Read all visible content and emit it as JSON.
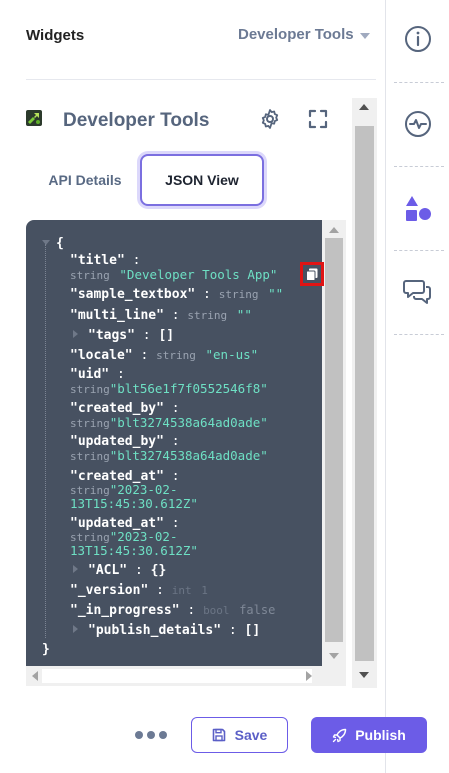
{
  "header": {
    "title": "Widgets",
    "selected_widget": "Developer Tools"
  },
  "rail": {
    "icons": [
      "info-icon",
      "activity-icon",
      "shapes-icon",
      "chat-icon"
    ]
  },
  "panel": {
    "title": "Developer Tools",
    "tabs": [
      {
        "label": "API Details",
        "active": false
      },
      {
        "label": "JSON View",
        "active": true
      }
    ]
  },
  "json": {
    "open_brace": "{",
    "close_brace": "}",
    "fields": {
      "title": {
        "key": "\"title\"",
        "type": "string",
        "value": "\"Developer Tools App\""
      },
      "sample_textbox": {
        "key": "\"sample_textbox\"",
        "type": "string",
        "value": "\"\""
      },
      "multi_line": {
        "key": "\"multi_line\"",
        "type": "string",
        "value": "\"\""
      },
      "tags": {
        "key": "\"tags\"",
        "value": "[]"
      },
      "locale": {
        "key": "\"locale\"",
        "type": "string",
        "value": "\"en-us\""
      },
      "uid": {
        "key": "\"uid\"",
        "type": "string",
        "value": "\"blt56e1f7f0552546f8\""
      },
      "created_by": {
        "key": "\"created_by\"",
        "type": "string",
        "value": "\"blt3274538a64ad0ade\""
      },
      "updated_by": {
        "key": "\"updated_by\"",
        "type": "string",
        "value": "\"blt3274538a64ad0ade\""
      },
      "created_at": {
        "key": "\"created_at\"",
        "type": "string",
        "value_line1": "\"2023-02-",
        "value_line2": "13T15:45:30.612Z\""
      },
      "updated_at": {
        "key": "\"updated_at\"",
        "type": "string",
        "value_line1": "\"2023-02-",
        "value_line2": "13T15:45:30.612Z\""
      },
      "acl": {
        "key": "\"ACL\"",
        "value": "{}"
      },
      "version": {
        "key": "\"_version\"",
        "type": "int",
        "value": "1"
      },
      "in_progress": {
        "key": "\"_in_progress\"",
        "type": "bool",
        "value": "false"
      },
      "publish_details": {
        "key": "\"publish_details\"",
        "value": "[]"
      }
    }
  },
  "footer": {
    "save_label": "Save",
    "publish_label": "Publish"
  },
  "colors": {
    "accent": "#6c5ce7",
    "json_bg": "#475161",
    "json_string": "#6ee0c4",
    "highlight": "#e01414"
  }
}
